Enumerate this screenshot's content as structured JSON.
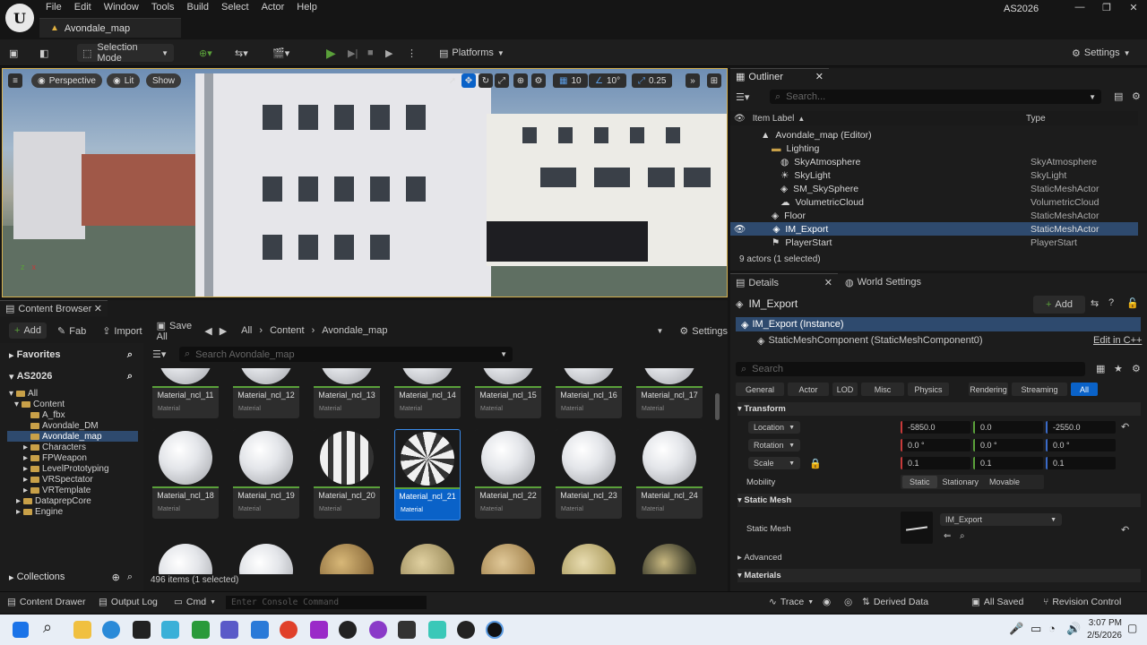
{
  "menu": [
    "File",
    "Edit",
    "Window",
    "Tools",
    "Build",
    "Select",
    "Actor",
    "Help"
  ],
  "map_tab": "Avondale_map",
  "project": "AS2026",
  "toolbar": {
    "selection_mode": "Selection Mode",
    "platforms": "Platforms",
    "settings": "Settings"
  },
  "viewport": {
    "perspective": "Perspective",
    "lit": "Lit",
    "show": "Show",
    "grid_snap": "10",
    "rot_snap": "10°",
    "scale_snap": "0.25"
  },
  "outliner": {
    "title": "Outliner",
    "search_placeholder": "Search...",
    "col_label": "Item Label",
    "col_type": "Type",
    "rows": [
      {
        "label": "Avondale_map (Editor)",
        "type": ""
      },
      {
        "label": "Lighting",
        "type": ""
      },
      {
        "label": "SkyAtmosphere",
        "type": "SkyAtmosphere"
      },
      {
        "label": "SkyLight",
        "type": "SkyLight"
      },
      {
        "label": "SM_SkySphere",
        "type": "StaticMeshActor"
      },
      {
        "label": "VolumetricCloud",
        "type": "VolumetricCloud"
      },
      {
        "label": "Floor",
        "type": "StaticMeshActor"
      },
      {
        "label": "IM_Export",
        "type": "StaticMeshActor"
      },
      {
        "label": "PlayerStart",
        "type": "PlayerStart"
      }
    ],
    "footer": "9 actors (1 selected)"
  },
  "details": {
    "tab": "Details",
    "tab2": "World Settings",
    "actor": "IM_Export",
    "add": "Add",
    "instance": "IM_Export (Instance)",
    "component": "StaticMeshComponent (StaticMeshComponent0)",
    "edit_cpp": "Edit in C++",
    "search_placeholder": "Search",
    "filters": [
      "General",
      "Actor",
      "LOD",
      "Misc",
      "Physics",
      "Rendering",
      "Streaming",
      "All"
    ],
    "transform_label": "Transform",
    "location_label": "Location",
    "rotation_label": "Rotation",
    "scale_label": "Scale",
    "mobility_label": "Mobility",
    "location": [
      "-5850.0",
      "0.0",
      "-2550.0"
    ],
    "rotation": [
      "0.0 °",
      "0.0 °",
      "0.0 °"
    ],
    "scale": [
      "0.1",
      "0.1",
      "0.1"
    ],
    "mobility": [
      "Static",
      "Stationary",
      "Movable"
    ],
    "static_mesh_section": "Static Mesh",
    "static_mesh_label": "Static Mesh",
    "static_mesh_value": "IM_Export",
    "advanced": "Advanced",
    "materials": "Materials"
  },
  "content_browser": {
    "title": "Content Browser",
    "add": "Add",
    "fab": "Fab",
    "import": "Import",
    "save_all": "Save All",
    "path": [
      "All",
      "Content",
      "Avondale_map"
    ],
    "settings": "Settings",
    "search_placeholder": "Search Avondale_map",
    "favorites": "Favorites",
    "project": "AS2026",
    "tree": [
      "All",
      "Content",
      "A_fbx",
      "Avondale_DM",
      "Avondale_map",
      "Characters",
      "FPWeapon",
      "LevelPrototyping",
      "VRSpectator",
      "VRTemplate",
      "DataprepCore",
      "Engine"
    ],
    "collections": "Collections",
    "count": "496 items (1 selected)",
    "type_label": "Material",
    "row1": [
      "Material_ncl_11",
      "Material_ncl_12",
      "Material_ncl_13",
      "Material_ncl_14",
      "Material_ncl_15",
      "Material_ncl_16",
      "Material_ncl_17"
    ],
    "row2": [
      "Material_ncl_18",
      "Material_ncl_19",
      "Material_ncl_20",
      "Material_ncl_21",
      "Material_ncl_22",
      "Material_ncl_23",
      "Material_ncl_24"
    ]
  },
  "statusbar": {
    "content_drawer": "Content Drawer",
    "output_log": "Output Log",
    "cmd": "Cmd",
    "console_placeholder": "Enter Console Command",
    "trace": "Trace",
    "derived_data": "Derived Data",
    "all_saved": "All Saved",
    "revision": "Revision Control"
  },
  "clock": {
    "time": "3:07 PM",
    "date": "2/5/2026"
  },
  "colors": {
    "accent": "#0a62c8",
    "selection_outline": "#d4b050"
  }
}
